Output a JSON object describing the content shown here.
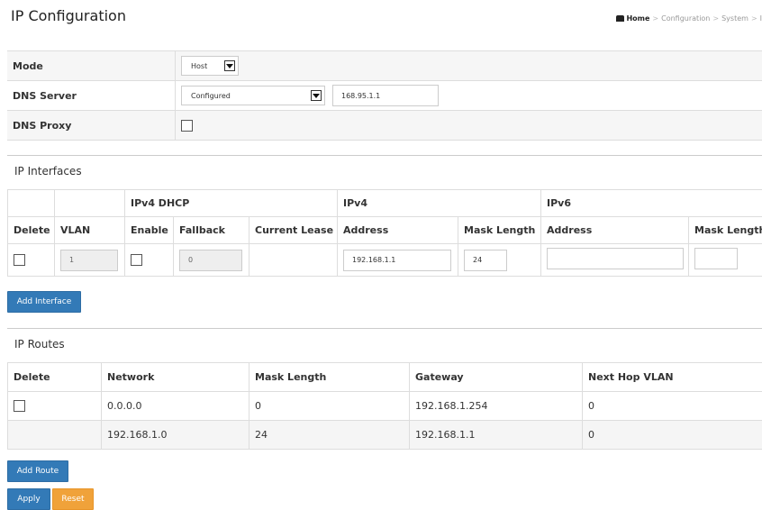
{
  "page": {
    "title": "IP Configuration",
    "breadcrumb": {
      "home": "Home",
      "sep": ">",
      "items": [
        "Configuration",
        "System",
        "I"
      ]
    }
  },
  "mode_table": {
    "mode": {
      "label": "Mode",
      "value": "Host"
    },
    "dns_server": {
      "label": "DNS Server",
      "source": "Configured",
      "address": "168.95.1.1"
    },
    "dns_proxy": {
      "label": "DNS Proxy",
      "checked": false
    }
  },
  "ip_interfaces": {
    "title": "IP Interfaces",
    "groups": {
      "dhcp": "IPv4 DHCP",
      "ipv4": "IPv4",
      "ipv6": "IPv6"
    },
    "headers": [
      "Delete",
      "VLAN",
      "Enable",
      "Fallback",
      "Current Lease",
      "Address",
      "Mask Length",
      "Address",
      "Mask Length"
    ],
    "row": {
      "vlan": "1",
      "fallback": "0",
      "current_lease": "",
      "ipv4_address": "192.168.1.1",
      "ipv4_mask": "24",
      "ipv6_address": "",
      "ipv6_mask": ""
    },
    "add_button": "Add Interface"
  },
  "ip_routes": {
    "title": "IP Routes",
    "headers": [
      "Delete",
      "Network",
      "Mask Length",
      "Gateway",
      "Next Hop VLAN"
    ],
    "rows": [
      {
        "network": "0.0.0.0",
        "mask": "0",
        "gateway": "192.168.1.254",
        "vlan": "0",
        "deletable": true
      },
      {
        "network": "192.168.1.0",
        "mask": "24",
        "gateway": "192.168.1.1",
        "vlan": "0",
        "deletable": false
      }
    ],
    "add_button": "Add Route"
  },
  "actions": {
    "apply": "Apply",
    "reset": "Reset"
  },
  "colors": {
    "primary_button": "#337ab7",
    "reset_button": "#f0a23a",
    "row_shade": "#f5f5f5"
  }
}
